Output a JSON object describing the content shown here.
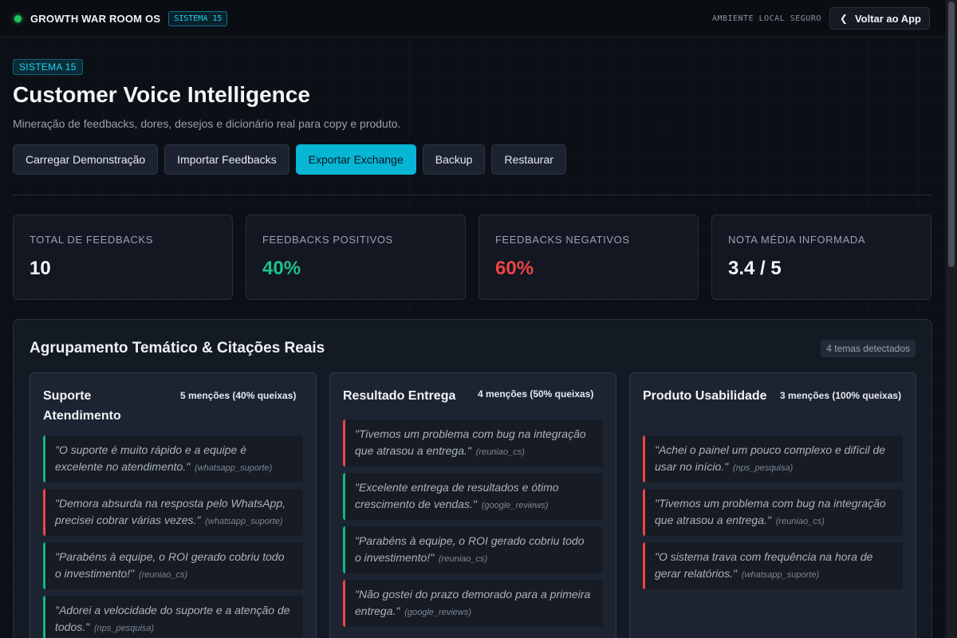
{
  "topbar": {
    "title": "GROWTH WAR ROOM OS",
    "badge": "SISTEMA 15",
    "env": "AMBIENTE LOCAL SEGURO",
    "back": "Voltar ao App"
  },
  "header": {
    "pill": "SISTEMA 15",
    "title": "Customer Voice Intelligence",
    "subtitle": "Mineração de feedbacks, dores, desejos e dicionário real para copy e produto."
  },
  "actions": [
    {
      "label": "Carregar Demonstração"
    },
    {
      "label": "Importar Feedbacks"
    },
    {
      "label": "Exportar Exchange"
    },
    {
      "label": "Backup"
    },
    {
      "label": "Restaurar"
    }
  ],
  "stats": [
    {
      "label": "TOTAL DE FEEDBACKS",
      "value": "10"
    },
    {
      "label": "FEEDBACKS POSITIVOS",
      "value": "40%"
    },
    {
      "label": "FEEDBACKS NEGATIVOS",
      "value": "60%"
    },
    {
      "label": "NOTA MÉDIA INFORMADA",
      "value": "3.4 / 5"
    }
  ],
  "panel": {
    "title": "Agrupamento Temático & Citações Reais",
    "badge": "4 temas detectados",
    "themes": [
      {
        "name": "Suporte Atendimento",
        "count": "5 menções (40% queixas)",
        "quotes": [
          {
            "text": "\"O suporte é muito rápido e a equipe é excelente no atendimento.\"",
            "source": "(whatsapp_suporte)"
          },
          {
            "text": "\"Demora absurda na resposta pelo WhatsApp, precisei cobrar várias vezes.\"",
            "source": "(whatsapp_suporte)"
          },
          {
            "text": "\"Parabéns à equipe, o ROI gerado cobriu todo o investimento!\"",
            "source": "(reuniao_cs)"
          },
          {
            "text": "\"Adorei a velocidade do suporte e a atenção de todos.\"",
            "source": "(nps_pesquisa)"
          }
        ]
      },
      {
        "name": "Resultado Entrega",
        "count": "4 menções (50% queixas)",
        "quotes": [
          {
            "text": "\"Tivemos um problema com bug na integração que atrasou a entrega.\"",
            "source": "(reuniao_cs)"
          },
          {
            "text": "\"Excelente entrega de resultados e ótimo crescimento de vendas.\"",
            "source": "(google_reviews)"
          },
          {
            "text": "\"Parabéns à equipe, o ROI gerado cobriu todo o investimento!\"",
            "source": "(reuniao_cs)"
          },
          {
            "text": "\"Não gostei do prazo demorado para a primeira entrega.\"",
            "source": "(google_reviews)"
          }
        ]
      },
      {
        "name": "Produto Usabilidade",
        "count": "3 menções (100% queixas)",
        "quotes": [
          {
            "text": "\"Achei o painel um pouco complexo e difícil de usar no início.\"",
            "source": "(nps_pesquisa)"
          },
          {
            "text": "\"Tivemos um problema com bug na integração que atrasou a entrega.\"",
            "source": "(reuniao_cs)"
          },
          {
            "text": "\"O sistema trava com frequência na hora de gerar relatórios.\"",
            "source": "(whatsapp_suporte)"
          }
        ]
      }
    ]
  }
}
